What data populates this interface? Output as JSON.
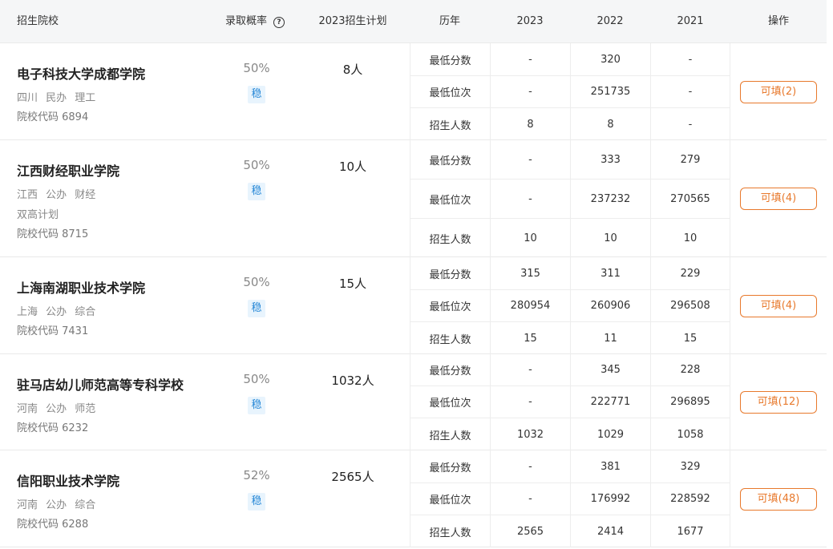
{
  "header": {
    "school": "招生院校",
    "probability": "录取概率",
    "plan": "2023招生计划",
    "history": "历年",
    "years": [
      "2023",
      "2022",
      "2021"
    ],
    "action": "操作"
  },
  "schools": [
    {
      "name": "电子科技大学成都学院",
      "tags": "四川 民办 理工",
      "extra": "",
      "code": "院校代码 6894",
      "probability": "50%",
      "badge": "稳",
      "plan": "8人",
      "rows": [
        {
          "label": "最低分数",
          "values": [
            "-",
            "320",
            "-"
          ]
        },
        {
          "label": "最低位次",
          "values": [
            "-",
            "251735",
            "-"
          ]
        },
        {
          "label": "招生人数",
          "values": [
            "8",
            "8",
            "-"
          ]
        }
      ],
      "button": "可填(2)"
    },
    {
      "name": "江西财经职业学院",
      "tags": "江西 公办 财经",
      "extra": "双高计划",
      "code": "院校代码 8715",
      "probability": "50%",
      "badge": "稳",
      "plan": "10人",
      "rows": [
        {
          "label": "最低分数",
          "values": [
            "-",
            "333",
            "279"
          ]
        },
        {
          "label": "最低位次",
          "values": [
            "-",
            "237232",
            "270565"
          ]
        },
        {
          "label": "招生人数",
          "values": [
            "10",
            "10",
            "10"
          ]
        }
      ],
      "button": "可填(4)"
    },
    {
      "name": "上海南湖职业技术学院",
      "tags": "上海 公办 综合",
      "extra": "",
      "code": "院校代码 7431",
      "probability": "50%",
      "badge": "稳",
      "plan": "15人",
      "rows": [
        {
          "label": "最低分数",
          "values": [
            "315",
            "311",
            "229"
          ]
        },
        {
          "label": "最低位次",
          "values": [
            "280954",
            "260906",
            "296508"
          ]
        },
        {
          "label": "招生人数",
          "values": [
            "15",
            "11",
            "15"
          ]
        }
      ],
      "button": "可填(4)"
    },
    {
      "name": "驻马店幼儿师范高等专科学校",
      "tags": "河南 公办 师范",
      "extra": "",
      "code": "院校代码 6232",
      "probability": "50%",
      "badge": "稳",
      "plan": "1032人",
      "rows": [
        {
          "label": "最低分数",
          "values": [
            "-",
            "345",
            "228"
          ]
        },
        {
          "label": "最低位次",
          "values": [
            "-",
            "222771",
            "296895"
          ]
        },
        {
          "label": "招生人数",
          "values": [
            "1032",
            "1029",
            "1058"
          ]
        }
      ],
      "button": "可填(12)"
    },
    {
      "name": "信阳职业技术学院",
      "tags": "河南 公办 综合",
      "extra": "",
      "code": "院校代码 6288",
      "probability": "52%",
      "badge": "稳",
      "plan": "2565人",
      "rows": [
        {
          "label": "最低分数",
          "values": [
            "-",
            "381",
            "329"
          ]
        },
        {
          "label": "最低位次",
          "values": [
            "-",
            "176992",
            "228592"
          ]
        },
        {
          "label": "招生人数",
          "values": [
            "2565",
            "2414",
            "1677"
          ]
        }
      ],
      "button": "可填(48)"
    }
  ]
}
